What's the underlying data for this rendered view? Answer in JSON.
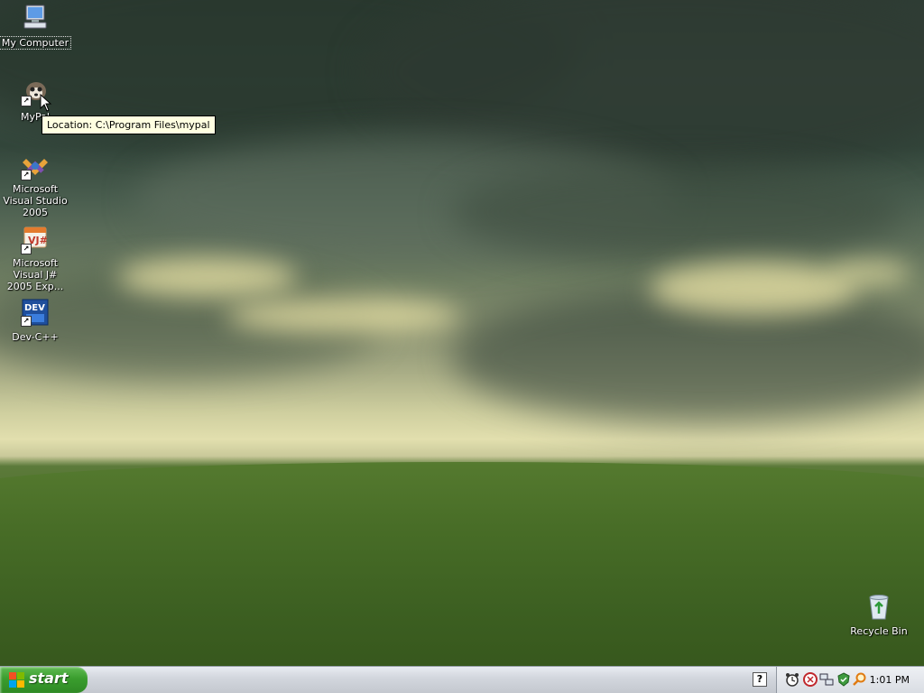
{
  "desktop": {
    "icons": [
      {
        "label": "My Computer",
        "icon": "computer-icon",
        "selected": true
      },
      {
        "label": "MyPal",
        "icon": "mypal-icon",
        "shortcut": true
      },
      {
        "label": "Microsoft Visual Studio 2005",
        "icon": "visual-studio-icon",
        "shortcut": true
      },
      {
        "label": "Microsoft Visual J# 2005 Exp...",
        "icon": "visual-jsharp-icon",
        "shortcut": true
      },
      {
        "label": "Dev-C++",
        "icon": "devcpp-icon",
        "shortcut": true
      },
      {
        "label": "Recycle Bin",
        "icon": "recycle-bin-icon"
      }
    ],
    "tooltip": "Location: C:\\Program Files\\mypal"
  },
  "taskbar": {
    "start_label": "start",
    "help_icon": "?",
    "tray_icons": [
      "alarm-icon",
      "antivirus-icon",
      "network-icon",
      "security-icon",
      "search-icon"
    ],
    "clock": "1:01 PM"
  },
  "colors": {
    "start_green": "#3a9d2e",
    "tooltip_bg": "#ffffe1",
    "taskbar": "#d3d7de"
  }
}
